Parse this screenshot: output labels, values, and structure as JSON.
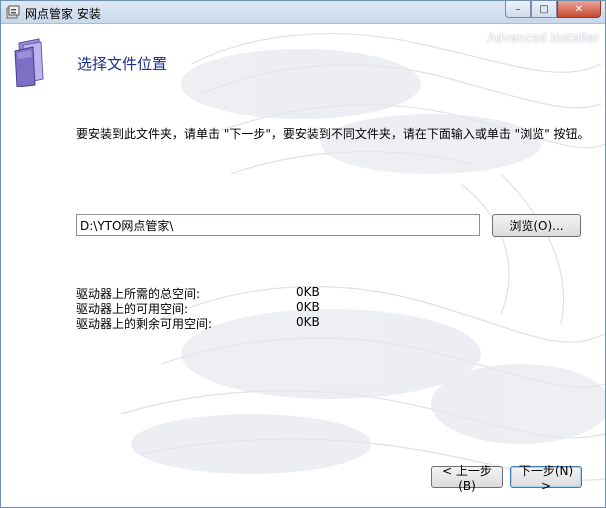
{
  "window": {
    "title": "网点管家 安装"
  },
  "caption": {
    "minimize": "–",
    "maximize": "□",
    "close": "✕"
  },
  "header": {
    "watermark": "Advanced Installer",
    "title": "选择文件位置"
  },
  "instruction": "要安装到此文件夹，请单击 \"下一步\"，要安装到不同文件夹，请在下面输入或单击 \"浏览\" 按钮。",
  "path": {
    "value": "D:\\YTO网点管家\\"
  },
  "browse_label": "浏览(O)...",
  "space": [
    {
      "label": "驱动器上所需的总空间:",
      "value": "0KB"
    },
    {
      "label": "驱动器上的可用空间:",
      "value": "0KB"
    },
    {
      "label": "驱动器上的剩余可用空间:",
      "value": "0KB"
    }
  ],
  "nav": {
    "back_label": "< 上一步(B)",
    "next_label": "下一步(N) >"
  }
}
